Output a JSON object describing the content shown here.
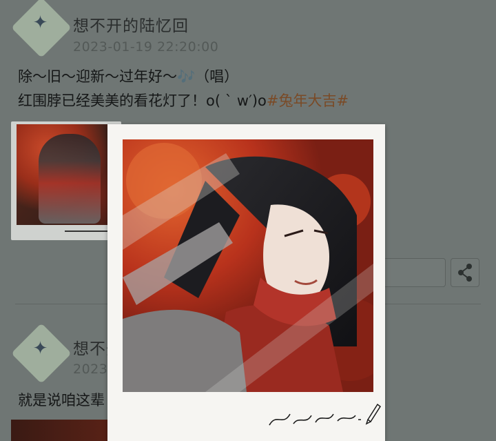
{
  "post1": {
    "author": "想不开的陆忆回",
    "timestamp": "2023-01-19 22:20:00",
    "line1": "除～旧～迎新～过年好～🎶（唱）",
    "line2_text": "红围脖已经美美的看花灯了！o( ` w′)o",
    "line2_hashtag": "#兔年大吉#"
  },
  "post2": {
    "author_partial": "想不开",
    "timestamp_partial": "2023-",
    "text_partial": "就是说咱这辈"
  },
  "icons": {
    "avatar": "butterfly-icon",
    "share": "share-icon",
    "pen": "pen-icon"
  },
  "colors": {
    "hashtag": "#7a4a26",
    "overlay_dim": "#6f7674"
  }
}
